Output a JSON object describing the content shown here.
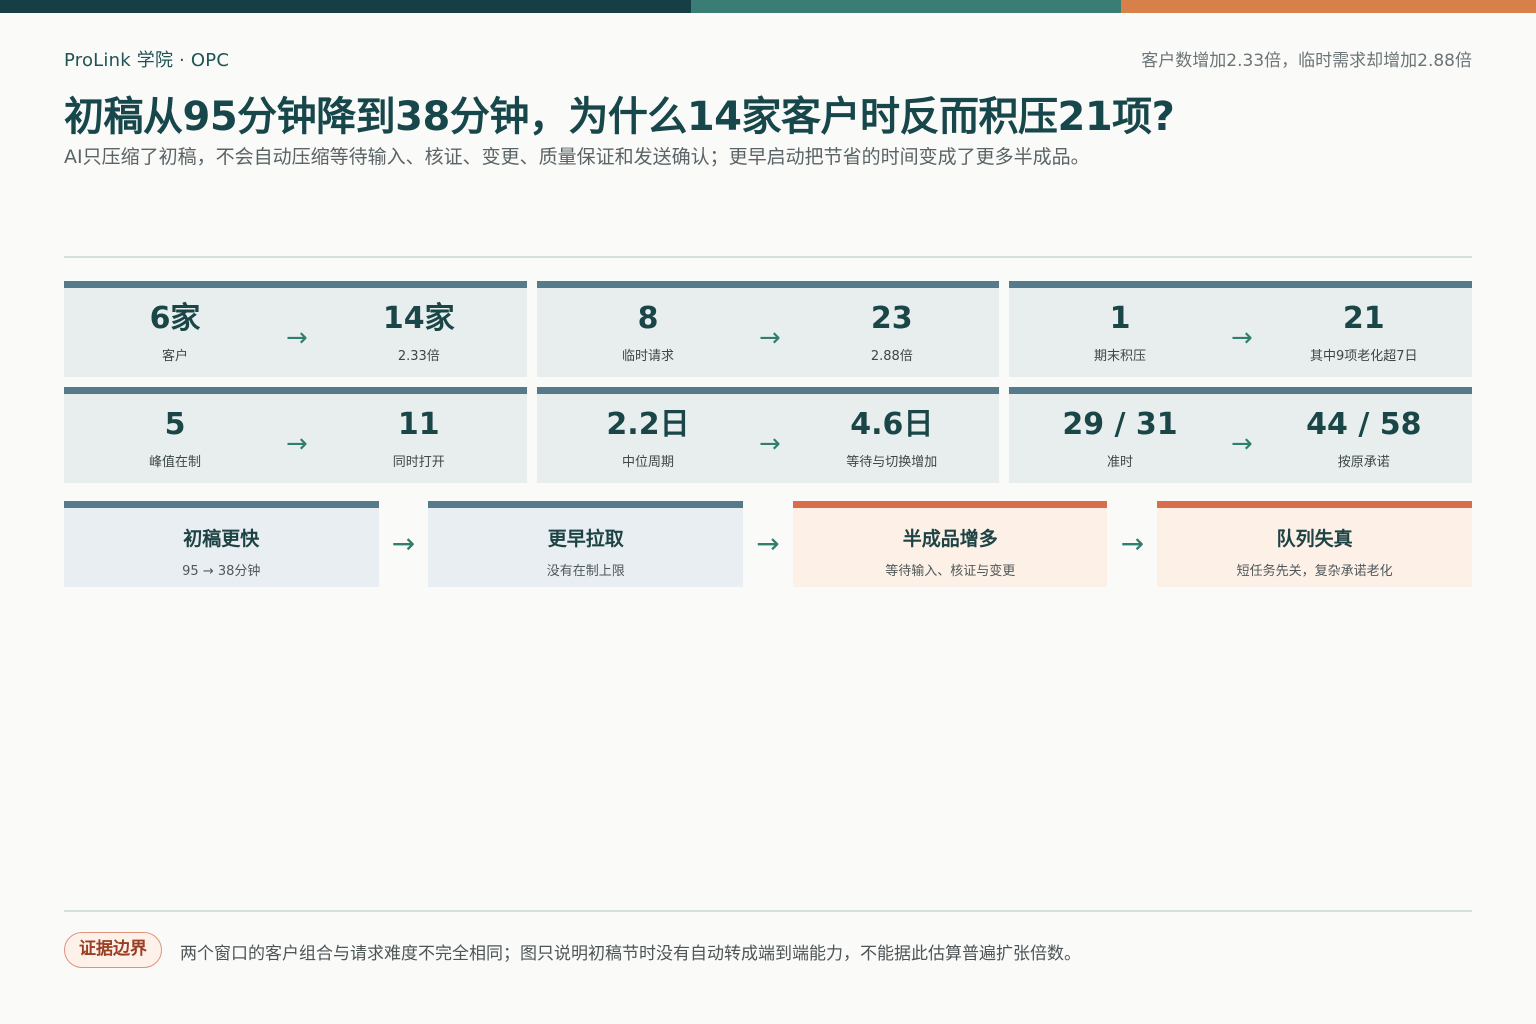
{
  "colors": {
    "bar_dark": "#163f45",
    "bar_teal": "#3a7d74",
    "bar_orange": "#d7804a",
    "card_accent": "#557a8a",
    "warm_accent": "#d96c4b"
  },
  "header": {
    "brand": "ProLink 学院 · OPC",
    "summary": "客户数增加2.33倍，临时需求却增加2.88倍",
    "title": "初稿从95分钟降到38分钟，为什么14家客户时反而积压21项?",
    "subtitle": "AI只压缩了初稿，不会自动压缩等待输入、核证、变更、质量保证和发送确认；更早启动把节省的时间变成了更多半成品。"
  },
  "metrics": [
    {
      "before": "6家",
      "before_label": "客户",
      "after": "14家",
      "after_label": "2.33倍"
    },
    {
      "before": "8",
      "before_label": "临时请求",
      "after": "23",
      "after_label": "2.88倍"
    },
    {
      "before": "1",
      "before_label": "期末积压",
      "after": "21",
      "after_label": "其中9项老化超7日"
    },
    {
      "before": "5",
      "before_label": "峰值在制",
      "after": "11",
      "after_label": "同时打开"
    },
    {
      "before": "2.2日",
      "before_label": "中位周期",
      "after": "4.6日",
      "after_label": "等待与切换增加"
    },
    {
      "before": "29 / 31",
      "before_label": "准时",
      "after": "44 / 58",
      "after_label": "按原承诺"
    }
  ],
  "arrow": "→",
  "flow": [
    {
      "title": "初稿更快",
      "sub": "95 → 38分钟"
    },
    {
      "title": "更早拉取",
      "sub": "没有在制上限"
    },
    {
      "title": "半成品增多",
      "sub": "等待输入、核证与变更"
    },
    {
      "title": "队列失真",
      "sub": "短任务先关，复杂承诺老化"
    }
  ],
  "footer": {
    "badge": "证据边界",
    "note": "两个窗口的客户组合与请求难度不完全相同；图只说明初稿节时没有自动转成端到端能力，不能据此估算普遍扩张倍数。"
  }
}
